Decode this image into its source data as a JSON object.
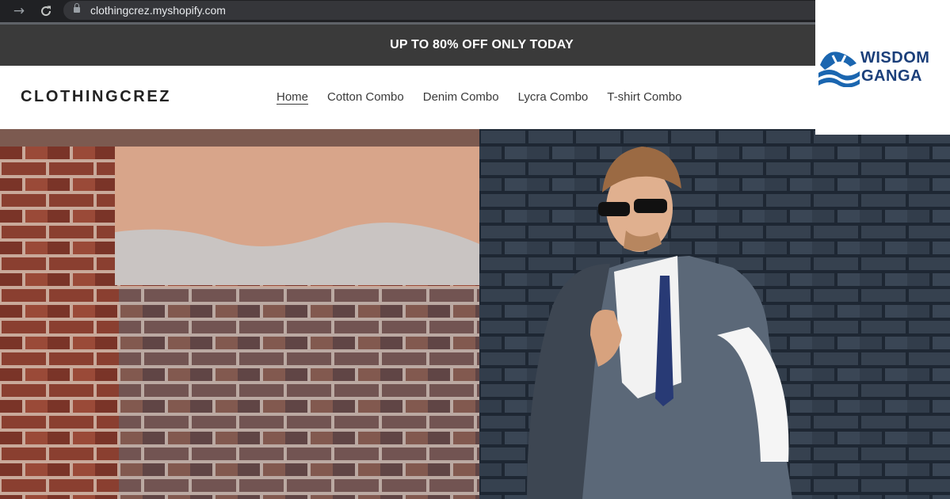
{
  "browser": {
    "forward_icon": "arrow-right-icon",
    "reload_icon": "reload-icon",
    "lock_icon": "lock-icon",
    "url": "clothingcrez.myshopify.com"
  },
  "announcement": {
    "text": "UP TO 80% OFF ONLY TODAY"
  },
  "header": {
    "logo": "CLOTHINGCREZ",
    "nav": [
      {
        "label": "Home",
        "active": true
      },
      {
        "label": "Cotton Combo",
        "active": false
      },
      {
        "label": "Denim Combo",
        "active": false
      },
      {
        "label": "Lycra Combo",
        "active": false
      },
      {
        "label": "T-shirt Combo",
        "active": false
      }
    ]
  },
  "hero": {
    "image": "man-in-suit-against-brick-wall"
  },
  "watermark": {
    "line1": "WISDOM",
    "line2": "GANGA"
  },
  "colors": {
    "announcement_bg": "#3a3a3a",
    "chrome_bg": "#202124",
    "brand_blue": "#1b3f7a"
  }
}
